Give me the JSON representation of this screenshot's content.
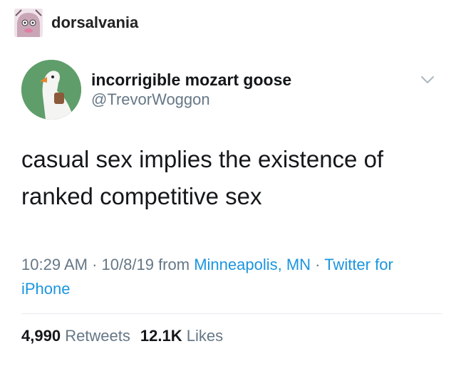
{
  "tumblr": {
    "username": "dorsalvania",
    "avatar_icon": "cartoon-avatar-icon"
  },
  "tweet": {
    "display_name": "incorrigible mozart goose",
    "handle": "@TrevorWoggon",
    "avatar_icon": "goose-avatar-icon",
    "menu_icon": "chevron-down-icon",
    "text_line1": "casual sex implies the existence of",
    "text_line2": "ranked competitive sex",
    "time": "10:29 AM",
    "separator": "·",
    "date": "10/8/19",
    "from_label": "from",
    "location": "Minneapolis, MN",
    "source": "Twitter for iPhone",
    "retweets_count": "4,990",
    "retweets_label": "Retweets",
    "likes_count": "12.1K",
    "likes_label": "Likes"
  },
  "colors": {
    "text": "#14171a",
    "secondary": "#657786",
    "link": "#1b95e0",
    "divider": "#e6ecf0",
    "avatar_bg": "#5f9e6a"
  }
}
